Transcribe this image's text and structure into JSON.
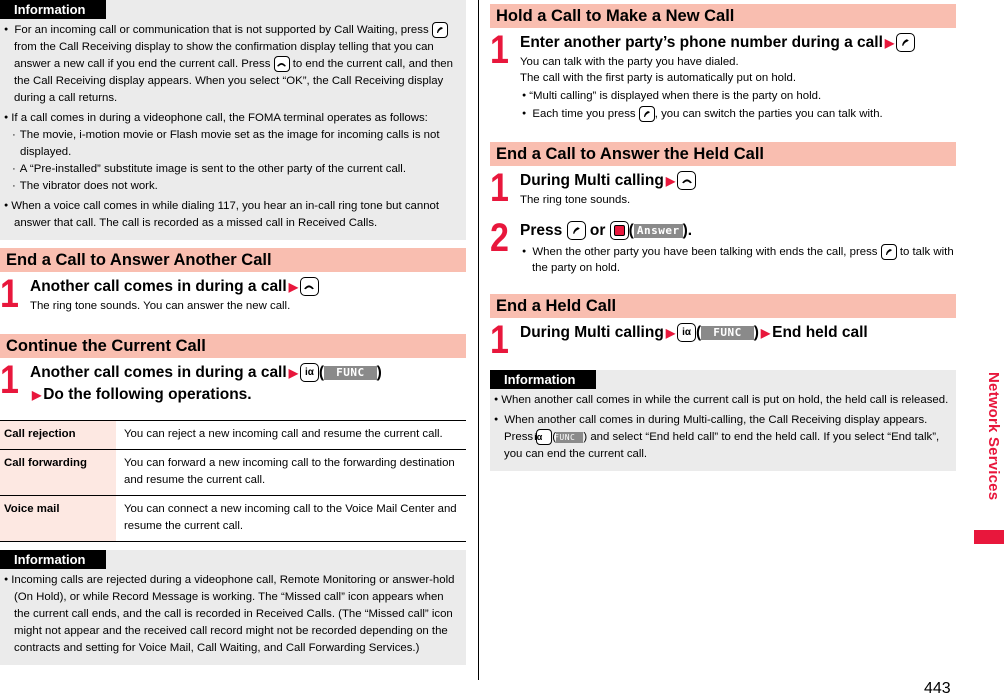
{
  "left": {
    "info1": {
      "tab": "Information",
      "bullets": [
        {
          "pre": "For an incoming call or communication that is not supported by Call Waiting, press",
          "mid": "from the Call Receiving display to show the confirmation display telling that you can answer a new call if you end the current call. Press",
          "post": "to end the current call, and then the Call Receiving display appears. When you select “OK”, the Call Receiving display during a call returns."
        },
        {
          "text": "If a call comes in during a videophone call, the FOMA terminal operates as follows:"
        },
        {
          "text": "When a voice call comes in while dialing 117, you hear an in-call ring tone but cannot answer that call. The call is recorded as a missed call in Received Calls."
        }
      ],
      "subs": [
        "The movie, i-motion movie or Flash movie set as the image for incoming calls is not displayed.",
        "A “Pre-installed” substitute image is sent to the other party of the current call.",
        "The vibrator does not work."
      ]
    },
    "section1": {
      "heading": "End a Call to Answer Another Call",
      "step_num": "1",
      "step_title": "Another call comes in during a call",
      "step_desc": "The ring tone sounds. You can answer the new call."
    },
    "section2": {
      "heading": "Continue the Current Call",
      "step_num": "1",
      "step_title": "Another call comes in during a call",
      "softkey": "FUNC",
      "step_title2": "Do the following operations."
    },
    "operations": [
      {
        "label": "Call rejection",
        "desc": "You can reject a new incoming call and resume the current call."
      },
      {
        "label": "Call forwarding",
        "desc": "You can forward a new incoming call to the forwarding destination and resume the current call."
      },
      {
        "label": "Voice mail",
        "desc": "You can connect a new incoming call to the Voice Mail Center and resume the current call."
      }
    ],
    "info2": {
      "tab": "Information",
      "text": "Incoming calls are rejected during a videophone call, Remote Monitoring or answer-hold (On Hold), or while Record Message is working. The “Missed call” icon appears when the current call ends, and the call is recorded in Received Calls. (The “Missed call” icon might not appear and the received call record might not be recorded depending on the contracts and setting for Voice Mail, Call Waiting, and Call Forwarding Services.)"
    }
  },
  "right": {
    "section1": {
      "heading": "Hold a Call to Make a New Call",
      "step_num": "1",
      "step_title": "Enter another party’s phone number during a call",
      "desc1": "You can talk with the party you have dialed.",
      "desc2": "The call with the first party is automatically put on hold.",
      "bullet1": "“Multi calling” is displayed when there is the party on hold.",
      "bullet2_pre": "Each time you press",
      "bullet2_post": ", you can switch the parties you can talk with."
    },
    "section2": {
      "heading": "End a Call to Answer the Held Call",
      "step1_num": "1",
      "step1_title": "During Multi calling",
      "step1_desc": "The ring tone sounds.",
      "step2_num": "2",
      "step2_pre": "Press",
      "step2_or": "or",
      "step2_softkey": "Answer",
      "bullet_pre": "When the other party you have been talking with ends the call, press",
      "bullet_post": "to talk with the party on hold."
    },
    "section3": {
      "heading": "End a Held Call",
      "step_num": "1",
      "step_title": "During Multi calling",
      "softkey": "FUNC",
      "step_end": "End held call"
    },
    "info": {
      "tab": "Information",
      "bullet1": "When another call comes in while the current call is put on hold, the held call is released.",
      "bullet2_pre": "When another call comes in during Multi-calling, the Call Receiving display appears. Press",
      "softkey": "FUNC",
      "bullet2_post": ") and select “End held call” to end the held call. If you select “End talk”, you can end the current call."
    }
  },
  "side_label": "Network Services",
  "page_number": "443",
  "colors": {
    "accent": "#e8173c",
    "section_bg": "#f9beb0",
    "info_bg": "#ebebeb",
    "table_label_bg": "#fde8e2"
  }
}
